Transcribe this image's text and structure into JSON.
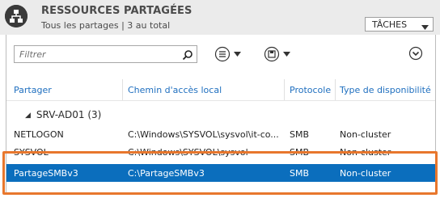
{
  "header": {
    "title": "RESSOURCES PARTAGÉES",
    "subtitle": "Tous les partages | 3 au total",
    "tasks_label": "TÂCHES"
  },
  "toolbar": {
    "filter_placeholder": "Filtrer",
    "icons": [
      "search-icon",
      "list-options-icon",
      "save-query-icon",
      "expand-circle-icon"
    ]
  },
  "columns": [
    "Partager",
    "Chemin d'accès local",
    "Protocole",
    "Type de disponibilité"
  ],
  "group": {
    "label": "SRV-AD01 (3)"
  },
  "rows": [
    {
      "name": "NETLOGON",
      "path": "C:\\Windows\\SYSVOL\\sysvol\\it-co...",
      "protocol": "SMB",
      "availability": "Non-cluster",
      "selected": false
    },
    {
      "name": "SYSVOL",
      "path": "C:\\Windows\\SYSVOL\\sysvol",
      "protocol": "SMB",
      "availability": "Non-cluster",
      "selected": false
    },
    {
      "name": "PartageSMBv3",
      "path": "C:\\PartageSMBv3",
      "protocol": "SMB",
      "availability": "Non-cluster",
      "selected": true
    }
  ],
  "colors": {
    "accent": "#1f6fbf",
    "selection": "#0b6ebd",
    "highlight": "#e8772d",
    "header_bg": "#ebebeb"
  }
}
